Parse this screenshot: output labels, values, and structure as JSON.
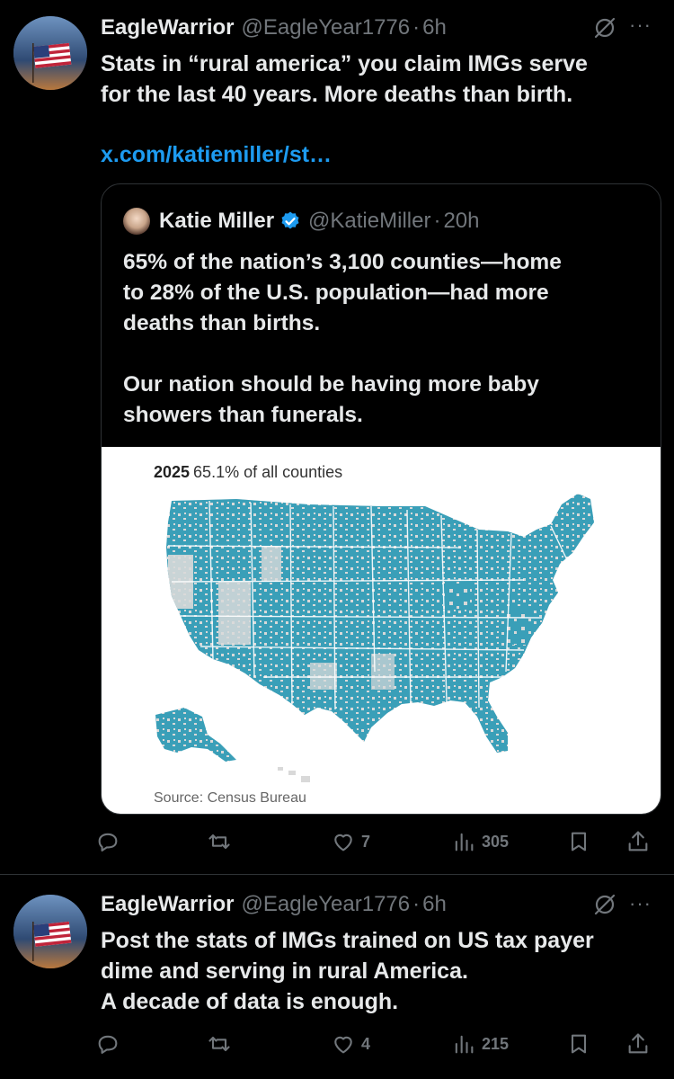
{
  "tweets": [
    {
      "author": "EagleWarrior",
      "handle": "@EagleYear1776",
      "time": "6h",
      "text": "Stats in “rural america” you claim IMGs serve\nfor the last 40 years. More deaths than birth.",
      "link": "x.com/katiemiller/st…",
      "likes": "7",
      "views": "305",
      "quote": {
        "author": "Katie Miller",
        "handle": "@KatieMiller",
        "time": "20h",
        "text": "65% of the nation’s 3,100 counties—home\nto 28% of the U.S. population—had more\ndeaths than births.\n\nOur nation should be having more baby\nshowers than funerals.",
        "map": {
          "year": "2025",
          "subtitle": "65.1% of all counties",
          "source": "Source: Census Bureau",
          "highlight_color": "#3a9fb8",
          "base_color": "#d9d9d9"
        }
      }
    },
    {
      "author": "EagleWarrior",
      "handle": "@EagleYear1776",
      "time": "6h",
      "text": "Post the stats of IMGs trained on US tax payer\ndime and serving in rural America.\nA decade of data is enough.",
      "likes": "4",
      "views": "215"
    }
  ],
  "dot": "·",
  "icons": {
    "reply": "reply-icon",
    "retweet": "retweet-icon",
    "like": "heart-icon",
    "views": "views-icon",
    "bookmark": "bookmark-icon",
    "share": "share-icon",
    "more": "more-icon",
    "grok": "grok-icon",
    "verified": "verified-badge-icon"
  }
}
